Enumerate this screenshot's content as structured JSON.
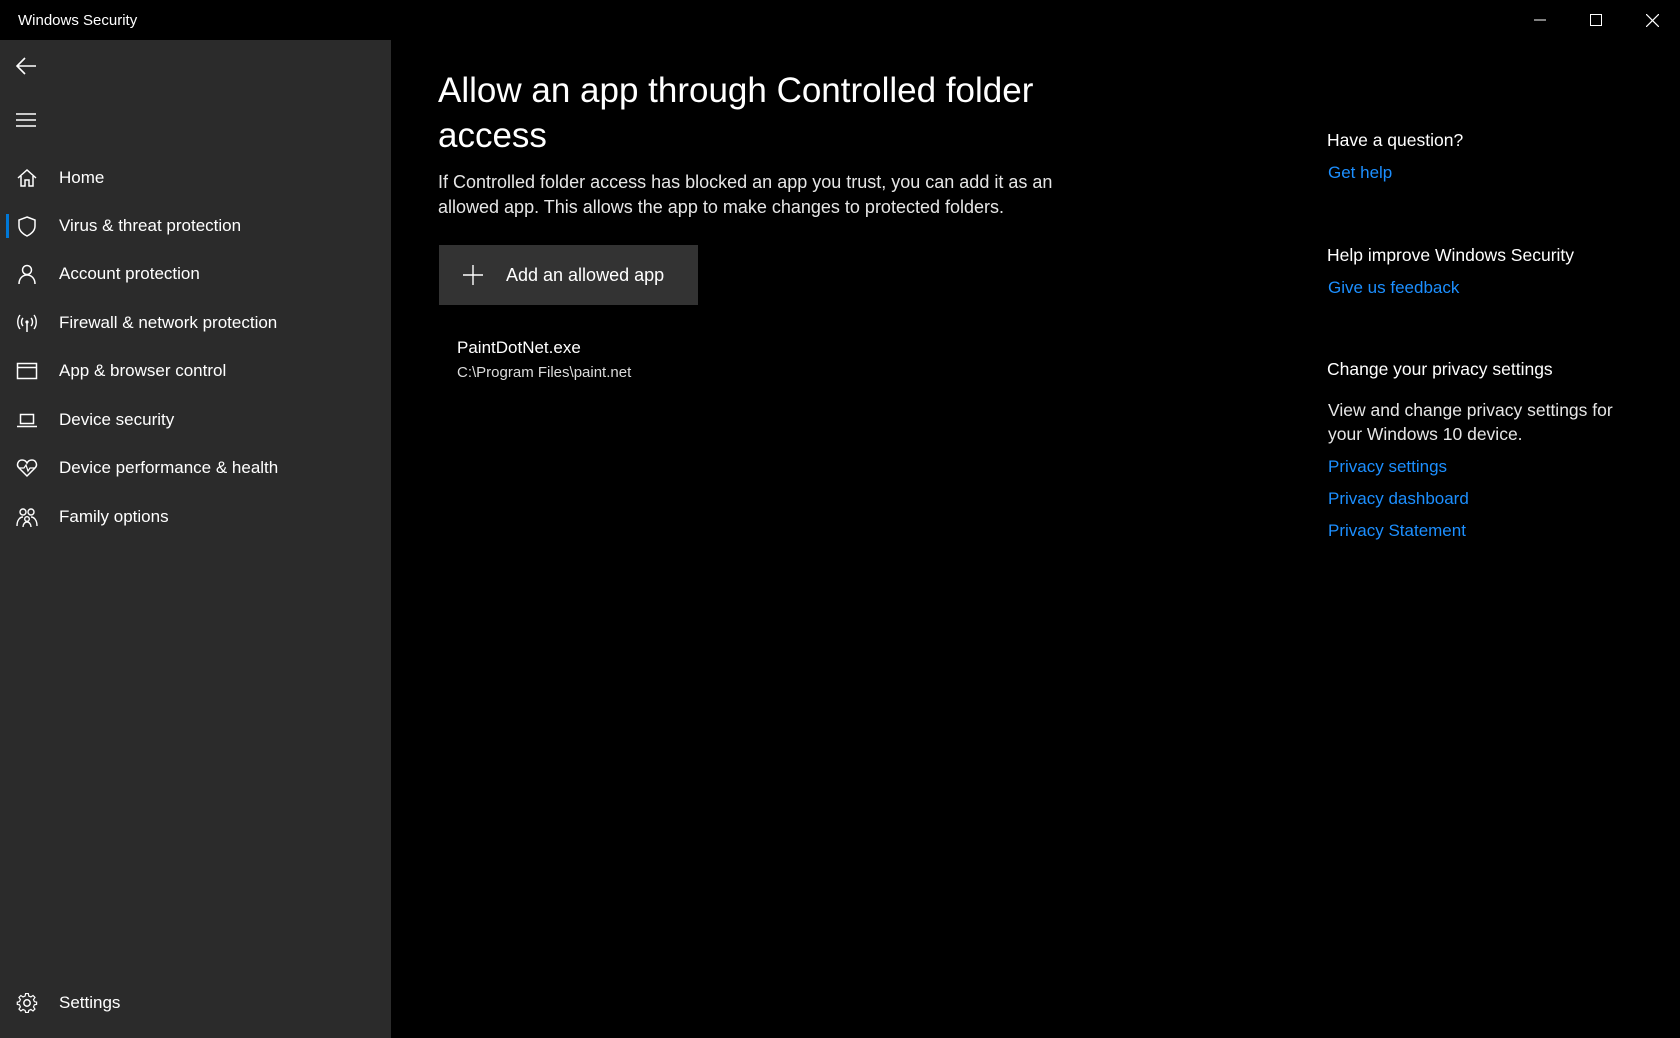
{
  "window": {
    "title": "Windows Security"
  },
  "sidebar": {
    "items": [
      {
        "label": "Home",
        "icon": "home-icon",
        "active": false
      },
      {
        "label": "Virus & threat protection",
        "icon": "shield-icon",
        "active": true
      },
      {
        "label": "Account protection",
        "icon": "person-icon",
        "active": false
      },
      {
        "label": "Firewall & network protection",
        "icon": "wireless-icon",
        "active": false
      },
      {
        "label": "App & browser control",
        "icon": "browser-window-icon",
        "active": false
      },
      {
        "label": "Device security",
        "icon": "laptop-icon",
        "active": false
      },
      {
        "label": "Device performance & health",
        "icon": "heart-pulse-icon",
        "active": false
      },
      {
        "label": "Family options",
        "icon": "family-icon",
        "active": false
      }
    ],
    "settings_label": "Settings"
  },
  "main": {
    "title": "Allow an app through Controlled folder access",
    "description": "If Controlled folder access has blocked an app you trust, you can add it as an allowed app. This allows the app to make changes to protected folders.",
    "add_button_label": "Add an allowed app",
    "allowed_apps": [
      {
        "name": "PaintDotNet.exe",
        "path": "C:\\Program Files\\paint.net"
      }
    ]
  },
  "right_panel": {
    "question_heading": "Have a question?",
    "get_help_link": "Get help",
    "improve_heading": "Help improve Windows Security",
    "feedback_link": "Give us feedback",
    "privacy_heading": "Change your privacy settings",
    "privacy_text": "View and change privacy settings for your Windows 10 device.",
    "privacy_links": [
      "Privacy settings",
      "Privacy dashboard",
      "Privacy Statement"
    ]
  },
  "colors": {
    "accent": "#0078d7",
    "link": "#1c8fff",
    "sidebar_bg": "#2b2b2b",
    "main_bg": "#000000",
    "button_bg": "#333333"
  }
}
